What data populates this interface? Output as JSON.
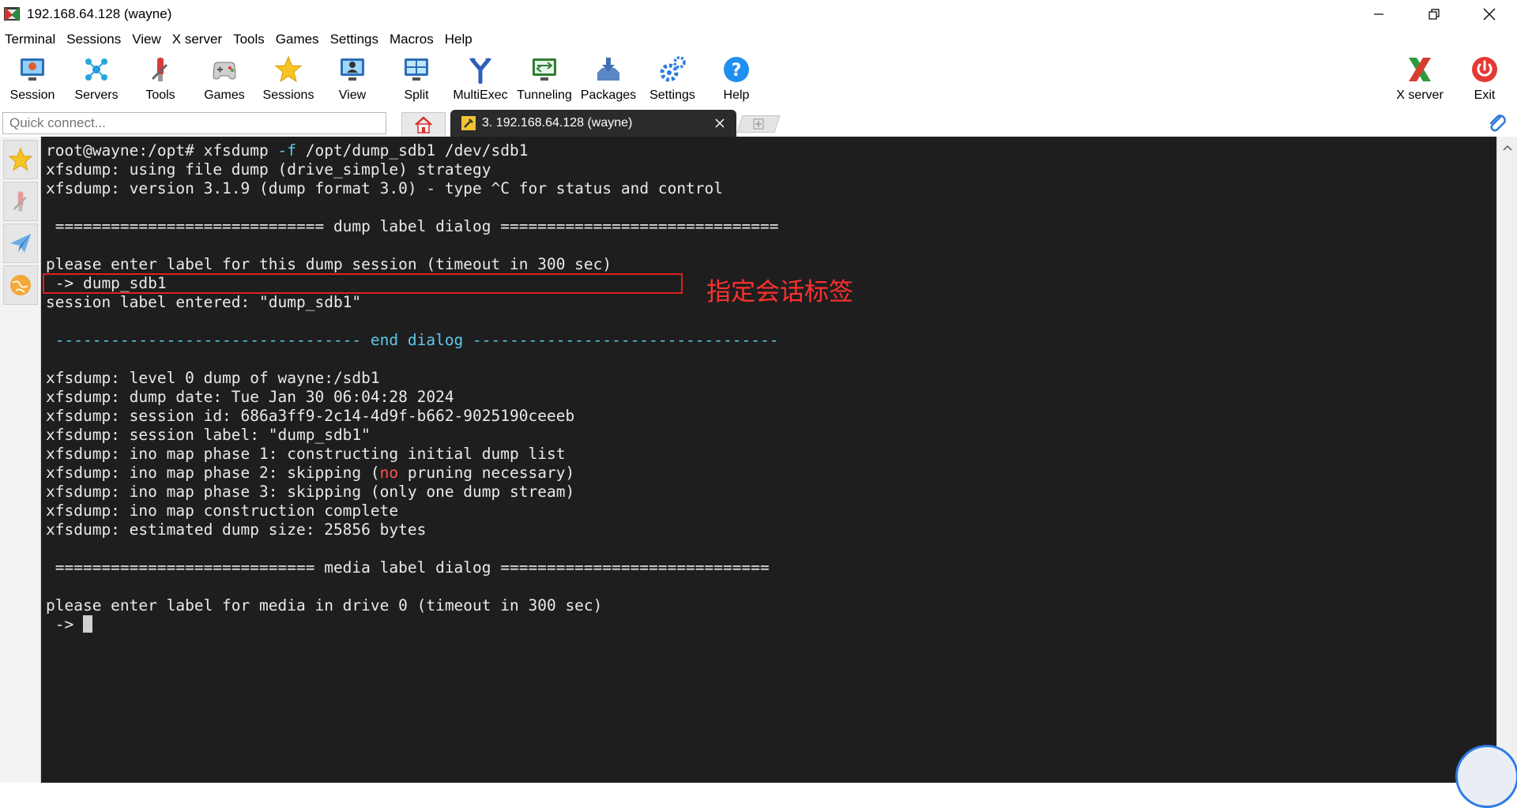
{
  "window": {
    "title": "192.168.64.128 (wayne)"
  },
  "menu": [
    "Terminal",
    "Sessions",
    "View",
    "X server",
    "Tools",
    "Games",
    "Settings",
    "Macros",
    "Help"
  ],
  "toolbar": {
    "session": "Session",
    "servers": "Servers",
    "tools": "Tools",
    "games": "Games",
    "sessions": "Sessions",
    "view": "View",
    "split": "Split",
    "multiexec": "MultiExec",
    "tunneling": "Tunneling",
    "packages": "Packages",
    "settings": "Settings",
    "help": "Help",
    "xserver": "X server",
    "exit": "Exit"
  },
  "tabs": {
    "quick_connect_placeholder": "Quick connect...",
    "active_session_label": "3. 192.168.64.128 (wayne)"
  },
  "terminal": {
    "lines": [
      "root@wayne:/opt# xfsdump ",
      "-f",
      " /opt/dump_sdb1 /dev/sdb1",
      "xfsdump: using file dump (drive_simple) strategy",
      "xfsdump: version 3.1.9 (dump format 3.0) - type ^C for status and control",
      " ============================= dump label dialog ==============================",
      "please enter label for this dump session (timeout in 300 sec)",
      " -> dump_sdb1",
      "session label entered: \"dump_sdb1\"",
      " --------------------------------- end dialog ---------------------------------",
      "xfsdump: level 0 dump of wayne:/sdb1",
      "xfsdump: dump date: Tue Jan 30 06:04:28 2024",
      "xfsdump: session id: 686a3ff9-2c14-4d9f-b662-9025190ceeeb",
      "xfsdump: session label: \"dump_sdb1\"",
      "xfsdump: ino map phase 1: constructing initial dump list",
      "xfsdump: ino map phase 2: skipping (",
      "no",
      " pruning necessary)",
      "xfsdump: ino map phase 3: skipping (only one dump stream)",
      "xfsdump: ino map construction complete",
      "xfsdump: estimated dump size: 25856 bytes",
      " ============================ media label dialog =============================",
      "please enter label for media in drive 0 (timeout in 300 sec)",
      " -> "
    ],
    "annotation": "指定会话标签"
  },
  "colors": {
    "terminal_bg": "#1e1e1e",
    "terminal_fg": "#eaeaea",
    "cyan": "#5fc8e8",
    "annotation_red": "#ff3030"
  }
}
